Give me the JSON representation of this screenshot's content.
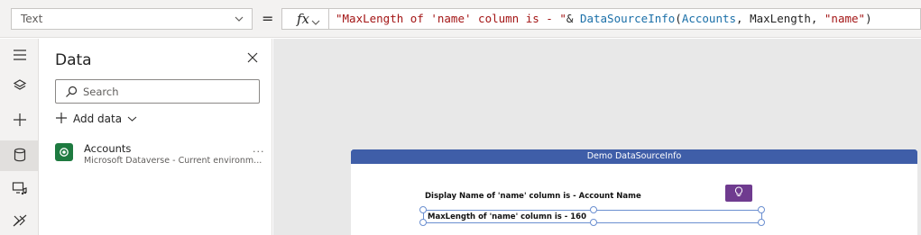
{
  "formula_bar": {
    "property": "Text",
    "equals": "=",
    "fx_label": "fx",
    "formula": {
      "string_part": "\"MaxLength of 'name' column is - \"",
      "amp": "& ",
      "function": "DataSourceInfo",
      "open_paren": "(",
      "arg1": "Accounts",
      "comma1": ", ",
      "arg2": "MaxLength",
      "comma2": ", ",
      "arg3": "\"name\"",
      "close_paren": ")"
    }
  },
  "rail": {
    "items": [
      {
        "icon": "hamburger-icon"
      },
      {
        "icon": "layers-icon"
      },
      {
        "icon": "plus-icon"
      },
      {
        "icon": "database-icon",
        "active": true
      },
      {
        "icon": "media-icon"
      },
      {
        "icon": "advanced-tools-icon"
      }
    ]
  },
  "data_pane": {
    "title": "Data",
    "search_placeholder": "Search",
    "add_data_label": "Add data",
    "sources": [
      {
        "name": "Accounts",
        "subtitle": "Microsoft Dataverse - Current environm...",
        "more": "..."
      }
    ]
  },
  "canvas": {
    "screen_header": "Demo DataSourceInfo",
    "label1": "Display Name of 'name' column is - Account Name",
    "label2": "MaxLength of 'name' column is - 160"
  },
  "colors": {
    "header_bar": "#3f5ea8",
    "idea_button": "#6f3b8f",
    "dataverse_green": "#1e7a40",
    "selection": "#6b8fd0"
  }
}
